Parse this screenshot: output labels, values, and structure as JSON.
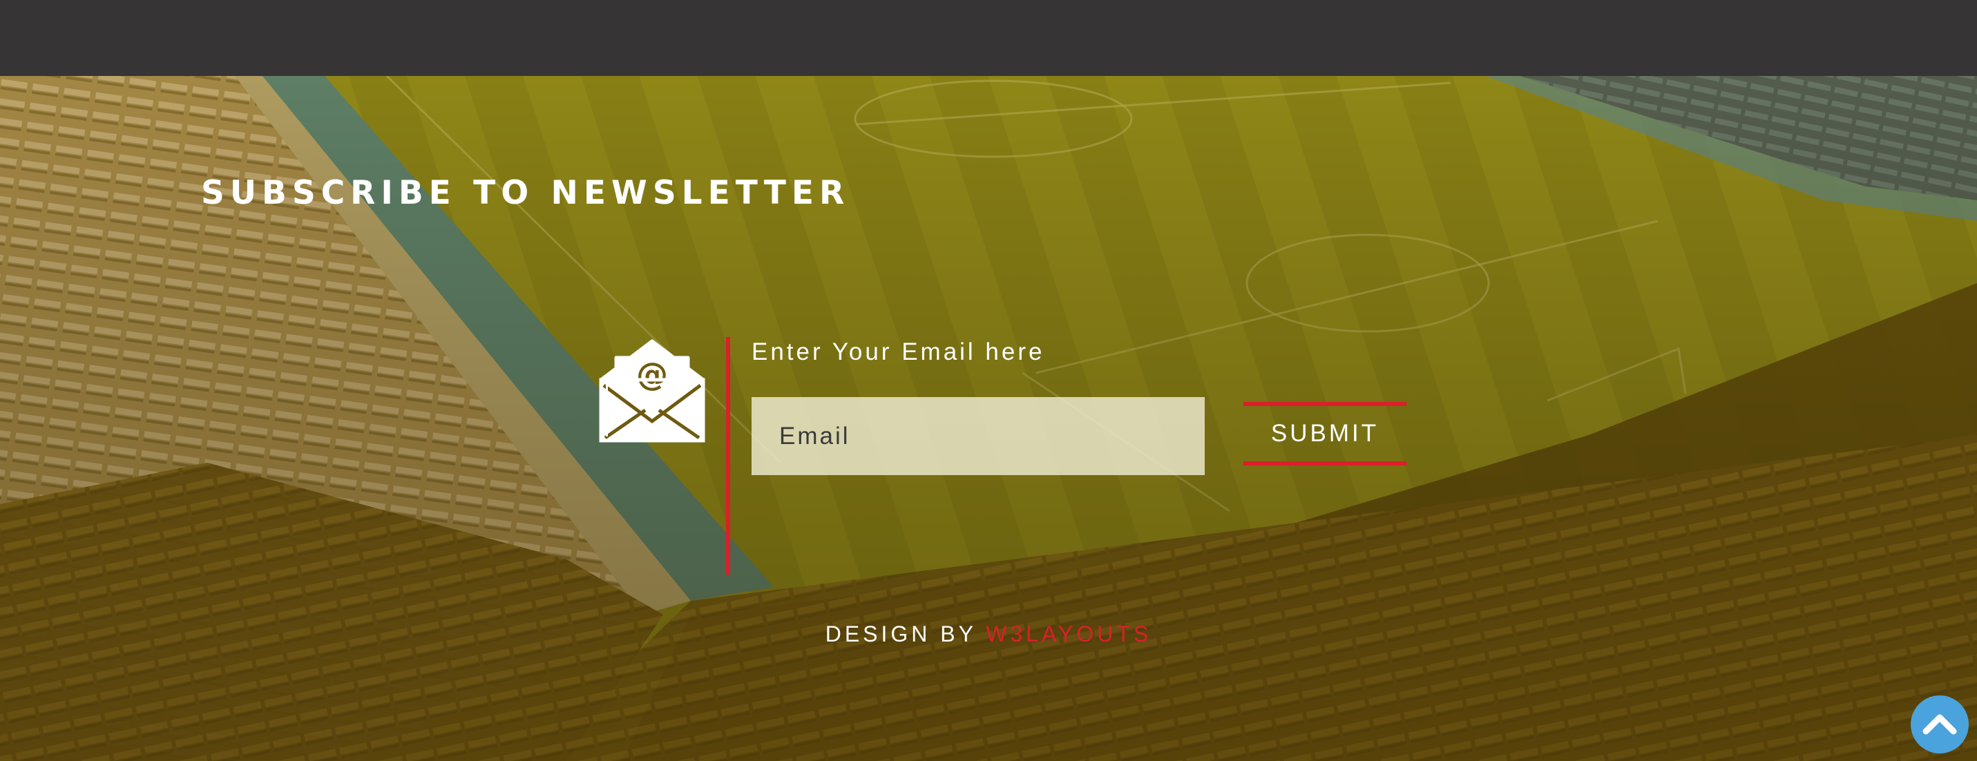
{
  "newsletter": {
    "title": "SUBSCRIBE TO NEWSLETTER",
    "email_label": "Enter Your Email here",
    "email_placeholder": "Email",
    "email_value": "",
    "submit_label": "SUBMIT"
  },
  "footer": {
    "prefix": "DESIGN BY",
    "brand": "W3LAYOUTS"
  },
  "icons": {
    "mail": "envelope-at-icon",
    "scroll_top": "chevron-up-icon"
  },
  "colors": {
    "accent": "#dc1f2a",
    "topbar": "#363435",
    "scroll_button": "#4aa3dc",
    "overlay": "#6f5a0f"
  }
}
